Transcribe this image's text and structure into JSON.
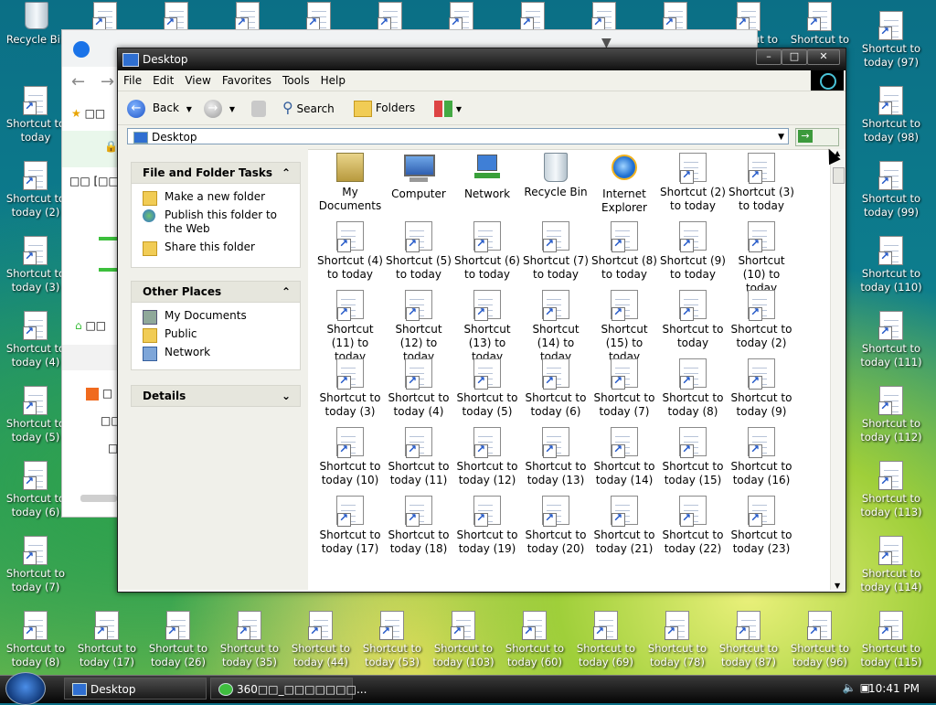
{
  "desktop": {
    "left_icons": [
      "Recycle Bin",
      "Shortcut to today",
      "Shortcut to today (2)",
      "Shortcut to today (3)",
      "Shortcut to today (4)",
      "Shortcut to today (5)",
      "Shortcut to today (6)",
      "Shortcut to today (7)",
      "Shortcut to today (8)"
    ],
    "right_icons": [
      "Shortcut to today (97)",
      "Shortcut to today (98)",
      "Shortcut to today (99)",
      "Shortcut to today (110)",
      "Shortcut to today (111)",
      "Shortcut to today (112)",
      "Shortcut to today (113)",
      "Shortcut to today (114)",
      "Shortcut to today (115)"
    ],
    "top_partial": [
      "Shortcut to",
      "Shortcut to"
    ],
    "bottom_row": [
      "Shortcut to today (17)",
      "Shortcut to today (26)",
      "Shortcut to today (35)",
      "Shortcut to today (44)",
      "Shortcut to today (53)",
      "Shortcut to today (103)",
      "Shortcut to today (60)",
      "Shortcut to today (69)",
      "Shortcut to today (78)",
      "Shortcut to today (87)",
      "Shortcut to today (96)"
    ]
  },
  "browser": {
    "star_text": "□□",
    "row2_text": "□□ [□□]",
    "home_text": "□□",
    "item1": "□",
    "item2": "□□",
    "item3": "□"
  },
  "window": {
    "title": "Desktop",
    "minimize": "–",
    "maximize": "□",
    "close": "✕"
  },
  "menubar": [
    "File",
    "Edit",
    "View",
    "Favorites",
    "Tools",
    "Help"
  ],
  "toolbar": {
    "back": "Back",
    "search": "Search",
    "folders": "Folders"
  },
  "address": {
    "value": "Desktop"
  },
  "tasks_panel": {
    "title": "File and Folder Tasks",
    "items": [
      "Make a new folder",
      "Publish this folder to the Web",
      "Share this folder"
    ]
  },
  "places_panel": {
    "title": "Other Places",
    "items": [
      "My Documents",
      "Public",
      "Network"
    ]
  },
  "details_panel": {
    "title": "Details"
  },
  "files": [
    {
      "label": "My Documents",
      "icon": "folder"
    },
    {
      "label": "Computer",
      "icon": "computer"
    },
    {
      "label": "Network",
      "icon": "network"
    },
    {
      "label": "Recycle Bin",
      "icon": "bin"
    },
    {
      "label": "Internet Explorer",
      "icon": "ie"
    },
    {
      "label": "Shortcut (2) to today",
      "icon": "shortcut"
    },
    {
      "label": "Shortcut (3) to today",
      "icon": "shortcut"
    },
    {
      "label": "Shortcut (4) to today",
      "icon": "shortcut"
    },
    {
      "label": "Shortcut (5) to today",
      "icon": "shortcut"
    },
    {
      "label": "Shortcut (6) to today",
      "icon": "shortcut"
    },
    {
      "label": "Shortcut (7) to today",
      "icon": "shortcut"
    },
    {
      "label": "Shortcut (8) to today",
      "icon": "shortcut"
    },
    {
      "label": "Shortcut (9) to today",
      "icon": "shortcut"
    },
    {
      "label": "Shortcut (10) to today",
      "icon": "shortcut"
    },
    {
      "label": "Shortcut (11) to today",
      "icon": "shortcut"
    },
    {
      "label": "Shortcut (12) to today",
      "icon": "shortcut"
    },
    {
      "label": "Shortcut (13) to today",
      "icon": "shortcut"
    },
    {
      "label": "Shortcut (14) to today",
      "icon": "shortcut"
    },
    {
      "label": "Shortcut (15) to today",
      "icon": "shortcut"
    },
    {
      "label": "Shortcut to today",
      "icon": "shortcut"
    },
    {
      "label": "Shortcut to today (2)",
      "icon": "shortcut"
    },
    {
      "label": "Shortcut to today (3)",
      "icon": "shortcut"
    },
    {
      "label": "Shortcut to today (4)",
      "icon": "shortcut"
    },
    {
      "label": "Shortcut to today (5)",
      "icon": "shortcut"
    },
    {
      "label": "Shortcut to today (6)",
      "icon": "shortcut"
    },
    {
      "label": "Shortcut to today (7)",
      "icon": "shortcut"
    },
    {
      "label": "Shortcut to today (8)",
      "icon": "shortcut"
    },
    {
      "label": "Shortcut to today (9)",
      "icon": "shortcut"
    },
    {
      "label": "Shortcut to today (10)",
      "icon": "shortcut"
    },
    {
      "label": "Shortcut to today (11)",
      "icon": "shortcut"
    },
    {
      "label": "Shortcut to today (12)",
      "icon": "shortcut"
    },
    {
      "label": "Shortcut to today (13)",
      "icon": "shortcut"
    },
    {
      "label": "Shortcut to today (14)",
      "icon": "shortcut"
    },
    {
      "label": "Shortcut to today (15)",
      "icon": "shortcut"
    },
    {
      "label": "Shortcut to today (16)",
      "icon": "shortcut"
    },
    {
      "label": "Shortcut to today (17)",
      "icon": "shortcut"
    },
    {
      "label": "Shortcut to today (18)",
      "icon": "shortcut"
    },
    {
      "label": "Shortcut to today (19)",
      "icon": "shortcut"
    },
    {
      "label": "Shortcut to today (20)",
      "icon": "shortcut"
    },
    {
      "label": "Shortcut to today (21)",
      "icon": "shortcut"
    },
    {
      "label": "Shortcut to today (22)",
      "icon": "shortcut"
    },
    {
      "label": "Shortcut to today (23)",
      "icon": "shortcut"
    }
  ],
  "taskbar": {
    "tasks": [
      "Desktop",
      "360□□_□□□□□□□..."
    ],
    "clock": "10:41 PM"
  }
}
